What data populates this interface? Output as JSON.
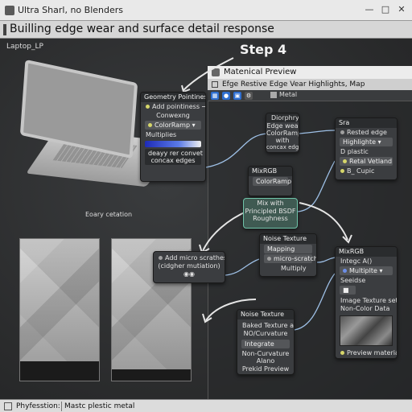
{
  "window": {
    "title": "Ultra Sharl, no Blenders",
    "controls": [
      "—",
      "□",
      "✕"
    ]
  },
  "heading": "Builling edge wear and surface detail response",
  "viewport": {
    "object_label": "Laptop_LP",
    "step_label": "Step 4",
    "texture_caption": "Eoary cetation"
  },
  "material_window": {
    "title": "Matenical Preview",
    "subtitle": "Efge Restive Edge Vear Highlights, Map",
    "material_field": "Metal",
    "tool_icons": [
      "grid-icon",
      "sphere-icon",
      "camera-icon",
      "gear-icon"
    ]
  },
  "nodes": {
    "geometry": {
      "title": "Geometry Pointiness",
      "row1": "Add pointiness →",
      "row2": "Conwexng",
      "row3": "ColorRamp",
      "row4": "Multiplies",
      "row5": "deayy rer convet",
      "row6": "concax edges"
    },
    "diorphry": {
      "line1": "Diorphry",
      "line2": "Edge wea",
      "line3": "ColorRamp",
      "line4": "with",
      "line5": "concax edges"
    },
    "rested": {
      "title": "Sra",
      "line1": "Rested edge",
      "line2": "Highlighte",
      "line3": "D plastic",
      "line4": "Retal Vetland",
      "line5": "B_ Cupic"
    },
    "mixrgb1": {
      "title": "MixRGB",
      "row1": "ColorRamp"
    },
    "mix_principled": {
      "line1": "Mix with",
      "line2": "Principled BSDF",
      "line3": "Roughness"
    },
    "noise1": {
      "title": "Noise Texture",
      "row1": "Mapping",
      "row2": "micro-scratch",
      "row3": "Multiply"
    },
    "micro": {
      "line1": "Add micro scrathesh",
      "line2": "(cidgher mutiation)"
    },
    "mixrgb2": {
      "title": "MixRGB",
      "row1": "Integc A()",
      "row2": "Multiplte",
      "row3": "Seeidse",
      "row4": "Image Texture set",
      "row5": "Non-Color Data",
      "row6": "Preview material"
    },
    "noise2": {
      "title": "Noise Texture",
      "row1": "Baked Texture as",
      "row2": "NO/Curvature",
      "row3": "Integrate",
      "row4": "Non-Curvature",
      "row5": "Alano",
      "row6": "Prekid Preview"
    }
  },
  "statusbar": {
    "left": "Phyfesstion:",
    "right": "Mastc plestic metal"
  }
}
